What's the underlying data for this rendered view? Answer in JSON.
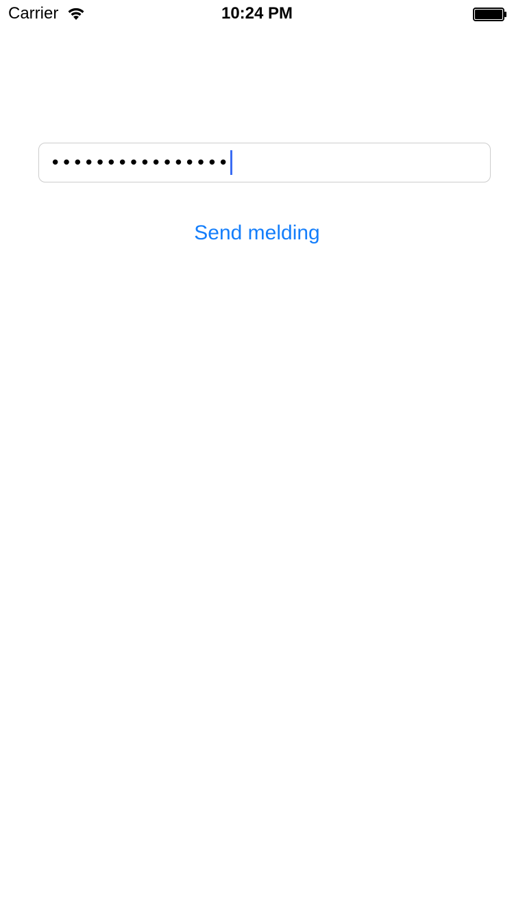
{
  "status_bar": {
    "carrier": "Carrier",
    "time": "10:24 PM",
    "wifi_icon": "wifi-icon",
    "battery_icon": "battery-icon",
    "battery_level": 1.0
  },
  "form": {
    "password_value": "••••••••••••••••",
    "caret_color": "#3a6cf3",
    "send_label": "Send melding",
    "accent_color": "#147efb"
  }
}
